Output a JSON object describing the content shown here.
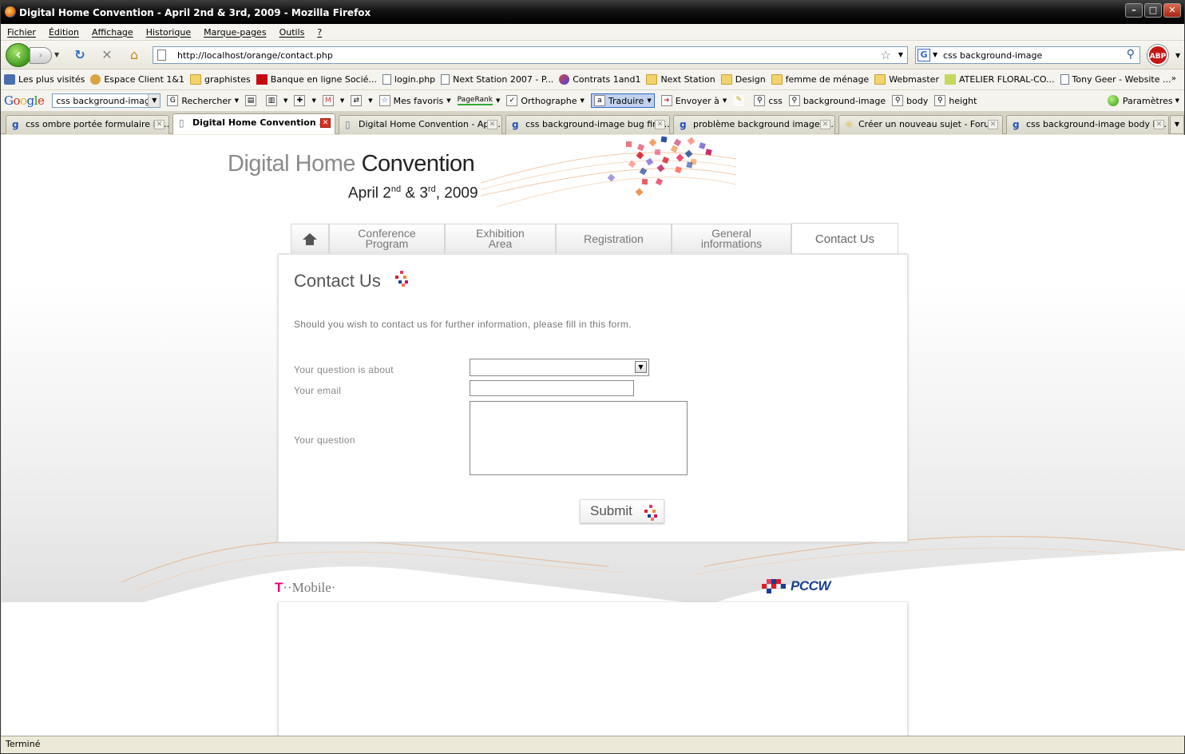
{
  "window": {
    "title": "Digital Home Convention - April 2nd & 3rd, 2009 - Mozilla Firefox"
  },
  "menu": [
    "Fichier",
    "Édition",
    "Affichage",
    "Historique",
    "Marque-pages",
    "Outils",
    "?"
  ],
  "navbar": {
    "url": "http://localhost/orange/contact.php",
    "search_value": "css background-image",
    "adblock_label": "ABP"
  },
  "bookmarks": [
    {
      "label": "Les plus visités",
      "icon": "visited"
    },
    {
      "label": "Espace Client 1&1",
      "icon": "person"
    },
    {
      "label": "graphistes",
      "icon": "folder"
    },
    {
      "label": "Banque en ligne Socié...",
      "icon": "red"
    },
    {
      "label": "login.php",
      "icon": "page"
    },
    {
      "label": "Next Station 2007 - P...",
      "icon": "page"
    },
    {
      "label": "Contrats 1and1",
      "icon": "special"
    },
    {
      "label": "Next Station",
      "icon": "folder"
    },
    {
      "label": "Design",
      "icon": "folder"
    },
    {
      "label": "femme de ménage",
      "icon": "folder"
    },
    {
      "label": "Webmaster",
      "icon": "folder"
    },
    {
      "label": "ATELIER FLORAL-CO...",
      "icon": "leaf"
    },
    {
      "label": "Tony Geer - Website ...",
      "icon": "page"
    }
  ],
  "google_toolbar": {
    "logo": "Google",
    "search_value": "css background-image",
    "search_label": "Rechercher",
    "favorites": "Mes favoris",
    "pagerank": "PageRank",
    "spell": "Orthographe",
    "translate": "Traduire",
    "send": "Envoyer à",
    "terms": [
      "css",
      "background-image",
      "body",
      "height"
    ],
    "settings": "Paramètres"
  },
  "tabs": [
    {
      "label": "css ombre portée formulaire in...",
      "active": false,
      "icon": "g"
    },
    {
      "label": "Digital Home Convention ...",
      "active": true,
      "icon": "page"
    },
    {
      "label": "Digital Home Convention - Apri...",
      "active": false,
      "icon": "page"
    },
    {
      "label": "css background-image bug fire...",
      "active": false,
      "icon": "g"
    },
    {
      "label": "problème background image a...",
      "active": false,
      "icon": "g"
    },
    {
      "label": "Créer un nouveau sujet - Foru...",
      "active": false,
      "icon": "sun"
    },
    {
      "label": "css background-image body h...",
      "active": false,
      "icon": "g"
    }
  ],
  "site": {
    "logo_line1_light": "Digital Home",
    "logo_line1_dark": "Convention",
    "logo_line2_a": "April 2",
    "logo_line2_sup1": "nd",
    "logo_line2_b": " & 3",
    "logo_line2_sup2": "rd",
    "logo_line2_c": ", 2009",
    "nav": [
      {
        "label": "",
        "type": "home"
      },
      {
        "label": "Conference\nProgram"
      },
      {
        "label": "Exhibition\nArea"
      },
      {
        "label": "Registration"
      },
      {
        "label": "General\ninformations"
      },
      {
        "label": "Contact Us",
        "active": true
      }
    ],
    "page_title": "Contact Us",
    "intro": "Should you wish to contact us for further information, please fill in this form.",
    "form": {
      "about_label": "Your question is about",
      "email_label": "Your email",
      "question_label": "Your question",
      "submit_label": "Submit"
    },
    "sponsors": {
      "tmobile_t": "T",
      "tmobile_rest": "··Mobile·",
      "pccw": "PCCW"
    }
  },
  "statusbar": {
    "text": "Terminé"
  }
}
